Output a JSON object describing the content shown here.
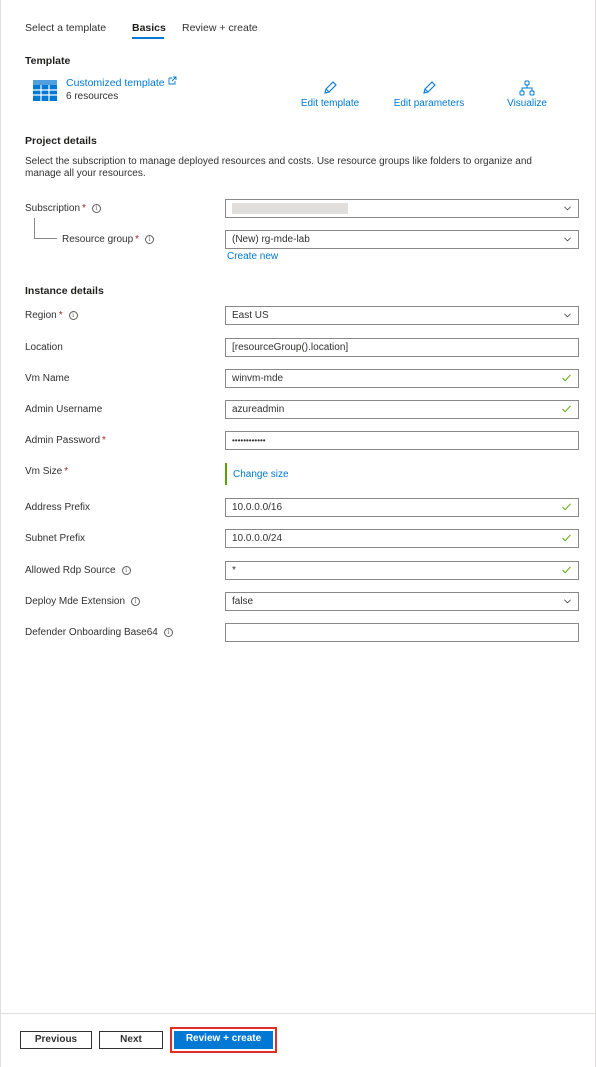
{
  "tabs": [
    {
      "label": "Select a template"
    },
    {
      "label": "Basics"
    },
    {
      "label": "Review + create"
    }
  ],
  "template": {
    "heading": "Template",
    "name": "Customized template",
    "resources": "6 resources",
    "actions": {
      "edit_template": "Edit template",
      "edit_parameters": "Edit parameters",
      "visualize": "Visualize"
    }
  },
  "project": {
    "heading": "Project details",
    "description": "Select the subscription to manage deployed resources and costs. Use resource groups like folders to organize and manage all your resources.",
    "subscription_label": "Subscription",
    "resource_group_label": "Resource group",
    "resource_group_value": "(New) rg-mde-lab",
    "create_new": "Create new"
  },
  "instance": {
    "heading": "Instance details",
    "region_label": "Region",
    "region_value": "East US",
    "location_label": "Location",
    "location_value": "[resourceGroup().location]",
    "vm_name_label": "Vm Name",
    "vm_name_value": "winvm-mde",
    "admin_username_label": "Admin Username",
    "admin_username_value": "azureadmin",
    "admin_password_label": "Admin Password",
    "admin_password_value": "••••••••••••",
    "vm_size_label": "Vm Size",
    "change_size": "Change size",
    "address_prefix_label": "Address Prefix",
    "address_prefix_value": "10.0.0.0/16",
    "subnet_prefix_label": "Subnet Prefix",
    "subnet_prefix_value": "10.0.0.0/24",
    "allowed_rdp_label": "Allowed Rdp Source",
    "allowed_rdp_value": "*",
    "deploy_mde_label": "Deploy Mde Extension",
    "deploy_mde_value": "false",
    "defender_label": "Defender Onboarding Base64",
    "defender_value": ""
  },
  "required_mark": "*",
  "footer": {
    "previous": "Previous",
    "next": "Next",
    "review_create": "Review + create"
  },
  "colors": {
    "accent": "#0078d4",
    "required": "#a4262c",
    "valid": "#57a300",
    "highlight": "#e02e2e"
  }
}
